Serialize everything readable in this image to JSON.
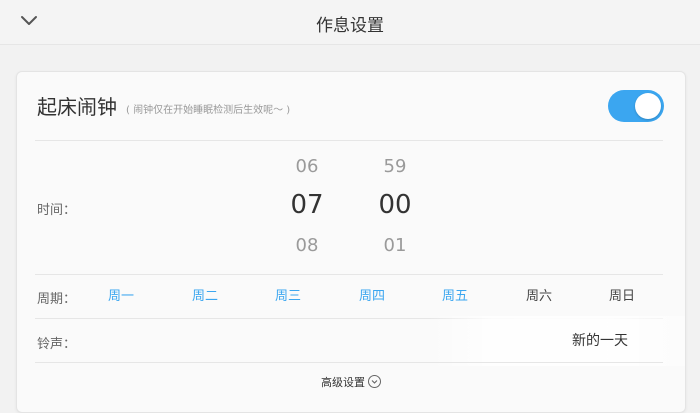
{
  "header": {
    "title": "作息设置",
    "back_icon": "chevron-down-icon"
  },
  "alarm": {
    "title": "起床闹钟",
    "note": "( 闹钟仅在开始睡眠检测后生效呢～ )",
    "enabled": true,
    "toggle_color": "#3ba6f0"
  },
  "time": {
    "label": "时间：",
    "hours": {
      "prev": "06",
      "selected": "07",
      "next": "08"
    },
    "minutes": {
      "prev": "59",
      "selected": "00",
      "next": "01"
    }
  },
  "period": {
    "label": "周期：",
    "days": [
      {
        "label": "周一",
        "active": true
      },
      {
        "label": "周二",
        "active": true
      },
      {
        "label": "周三",
        "active": true
      },
      {
        "label": "周四",
        "active": true
      },
      {
        "label": "周五",
        "active": true
      },
      {
        "label": "周六",
        "active": false
      },
      {
        "label": "周日",
        "active": false
      }
    ]
  },
  "ringtone": {
    "label": "铃声：",
    "value": "新的一天"
  },
  "advanced": {
    "label": "高级设置"
  }
}
